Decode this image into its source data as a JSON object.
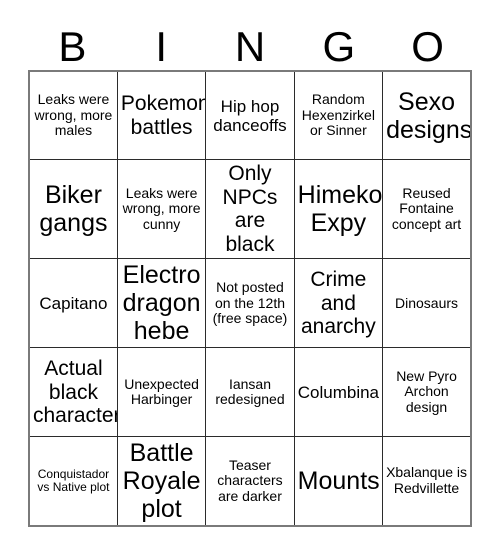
{
  "card": {
    "header_letters": [
      "B",
      "I",
      "N",
      "G",
      "O"
    ],
    "rows": [
      [
        {
          "text": "Leaks were wrong, more males",
          "size": "fs-sm"
        },
        {
          "text": "Pokemon battles",
          "size": "fs-lg"
        },
        {
          "text": "Hip hop danceoffs",
          "size": "fs-md"
        },
        {
          "text": "Random Hexenzirkel or Sinner",
          "size": "fs-sm"
        },
        {
          "text": "Sexo designs",
          "size": "fs-xl"
        }
      ],
      [
        {
          "text": "Biker gangs",
          "size": "fs-xl"
        },
        {
          "text": "Leaks were wrong, more cunny",
          "size": "fs-sm"
        },
        {
          "text": "Only NPCs are black",
          "size": "fs-lg"
        },
        {
          "text": "Himeko Expy",
          "size": "fs-xl"
        },
        {
          "text": "Reused Fontaine concept art",
          "size": "fs-sm"
        }
      ],
      [
        {
          "text": "Capitano",
          "size": "fs-md"
        },
        {
          "text": "Electro dragon hebe",
          "size": "fs-xl"
        },
        {
          "text": "Not posted on the 12th (free space)",
          "size": "fs-sm"
        },
        {
          "text": "Crime and anarchy",
          "size": "fs-lg"
        },
        {
          "text": "Dinosaurs",
          "size": "fs-sm"
        }
      ],
      [
        {
          "text": "Actual black character",
          "size": "fs-lg"
        },
        {
          "text": "Unexpected Harbinger",
          "size": "fs-sm"
        },
        {
          "text": "Iansan redesigned",
          "size": "fs-sm"
        },
        {
          "text": "Columbina",
          "size": "fs-md"
        },
        {
          "text": "New Pyro Archon design",
          "size": "fs-sm"
        }
      ],
      [
        {
          "text": "Conquistador vs Native plot",
          "size": "fs-xs"
        },
        {
          "text": "Battle Royale plot",
          "size": "fs-xl"
        },
        {
          "text": "Teaser characters are darker",
          "size": "fs-sm"
        },
        {
          "text": "Mounts",
          "size": "fs-xl"
        },
        {
          "text": "Xbalanque is Redvillette",
          "size": "fs-sm"
        }
      ]
    ]
  },
  "colors": {
    "background": "#ffffff",
    "text": "#000000",
    "cell_border": "#2b2b2b",
    "outer_border": "#7a7a7a"
  }
}
